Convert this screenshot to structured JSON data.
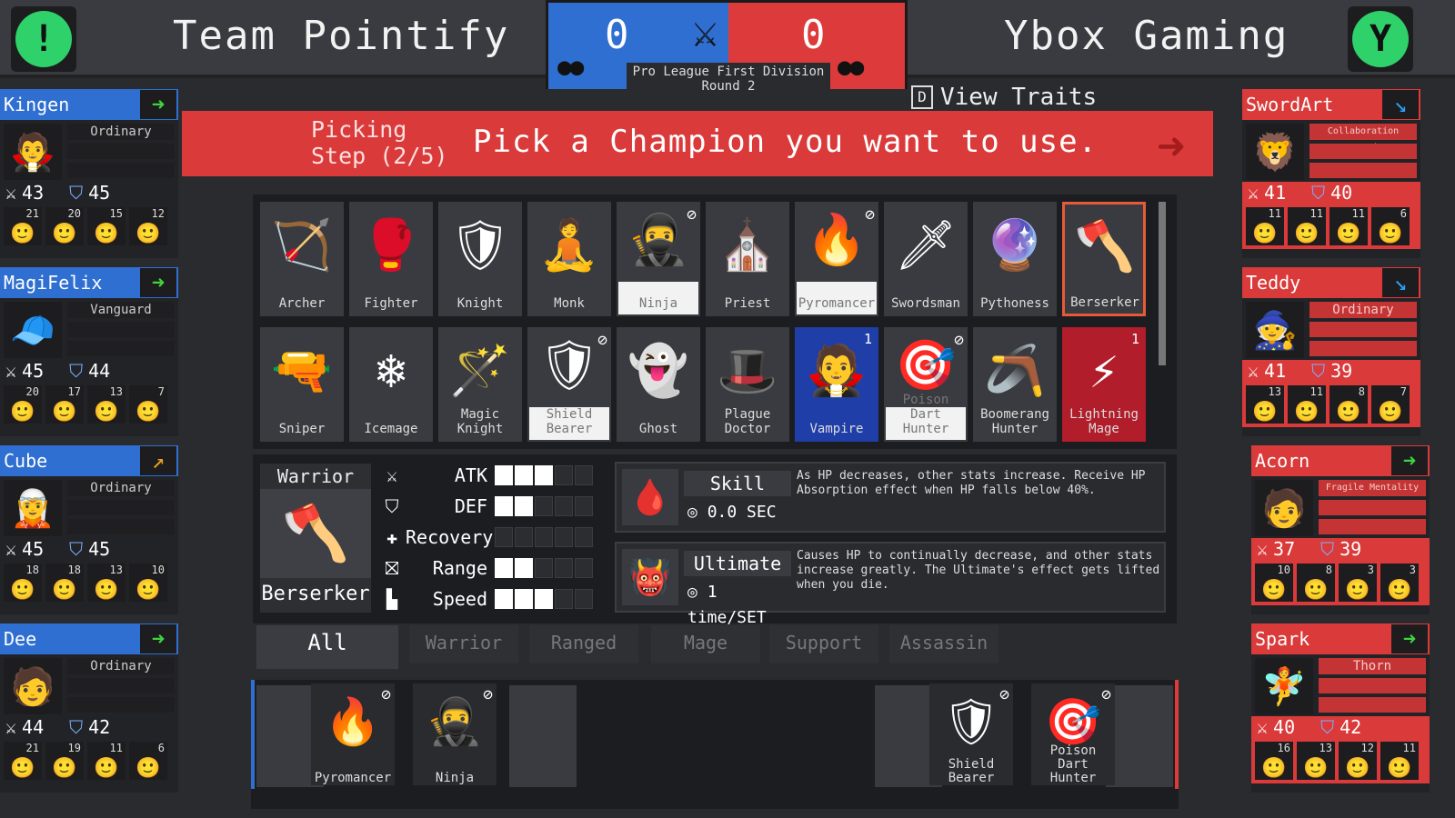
{
  "header": {
    "left_team": "Team Pointify",
    "right_team": "Ybox Gaming",
    "left_score": "0",
    "right_score": "0",
    "round": "Pro League First Division Round 2",
    "view_traits_key": "D",
    "view_traits": "View Traits",
    "left_color": "#2f6fd1",
    "right_color": "#dd3b3b"
  },
  "banner": {
    "step_line1": "Picking",
    "step_line2": "Step (2/5)",
    "prompt": "Pick a Champion you want to use."
  },
  "left_players": [
    {
      "name": "Kingen",
      "trait": "Ordinary",
      "atk": "43",
      "def": "45",
      "mini": [
        "21",
        "20",
        "15",
        "12"
      ]
    },
    {
      "name": "MagiFelix",
      "trait": "Vanguard",
      "atk": "45",
      "def": "44",
      "mini": [
        "20",
        "17",
        "13",
        "7"
      ]
    },
    {
      "name": "Cube",
      "trait": "Ordinary",
      "atk": "45",
      "def": "45",
      "mini": [
        "18",
        "18",
        "13",
        "10"
      ]
    },
    {
      "name": "Dee",
      "trait": "Ordinary",
      "atk": "44",
      "def": "42",
      "mini": [
        "21",
        "19",
        "11",
        "6"
      ]
    }
  ],
  "right_players": [
    {
      "name": "SwordArt",
      "trait": "Collaboration attack",
      "atk": "41",
      "def": "40",
      "mini": [
        "11",
        "11",
        "11",
        "6"
      ]
    },
    {
      "name": "Teddy",
      "trait": "Ordinary",
      "atk": "41",
      "def": "39",
      "mini": [
        "13",
        "11",
        "8",
        "7"
      ]
    },
    {
      "name": "Acorn",
      "trait": "Fragile Mentality",
      "atk": "37",
      "def": "39",
      "mini": [
        "10",
        "8",
        "3",
        "3"
      ]
    },
    {
      "name": "Spark",
      "trait": "Thorn",
      "atk": "40",
      "def": "42",
      "mini": [
        "16",
        "13",
        "12",
        "11"
      ]
    }
  ],
  "champions_row1": [
    "Archer",
    "Fighter",
    "Knight",
    "Monk",
    "Ninja",
    "Priest",
    "Pyromancer",
    "Swordsman",
    "Pythoness",
    "Berserker"
  ],
  "champions_row2": [
    "Sniper",
    "Icemage",
    "Magic Knight",
    "Shield Bearer",
    "Ghost",
    "Plague Doctor",
    "Vampire",
    "Poison Dart Hunter",
    "Boomerang Hunter",
    "Lightning Mage"
  ],
  "champion_counts": {
    "vampire": "1",
    "lightning_mage": "1"
  },
  "selected": {
    "class": "Warrior",
    "name": "Berserker",
    "stats": {
      "atk_label": "ATK",
      "atk": 3,
      "def_label": "DEF",
      "def": 2,
      "rec_label": "Recovery",
      "rec": 0,
      "range_label": "Range",
      "range": 2,
      "speed_label": "Speed",
      "speed": 3,
      "max": 5
    },
    "skill_title": "Skill",
    "skill_cd": "0.0 SEC",
    "skill_desc": "As HP decreases, other stats increase. Receive HP Absorption effect when HP falls below 40%.",
    "ult_title": "Ultimate",
    "ult_cd": "1 time/SET",
    "ult_desc": "Causes HP to continually decrease, and other stats increase greatly. The Ultimate's effect gets lifted when you die."
  },
  "filters": [
    "All",
    "Warrior",
    "Ranged",
    "Mage",
    "Support",
    "Assassin"
  ],
  "bans": {
    "left": [
      "Pyromancer",
      "Ninja"
    ],
    "right": [
      "Shield Bearer",
      "Poison Dart Hunter"
    ]
  }
}
